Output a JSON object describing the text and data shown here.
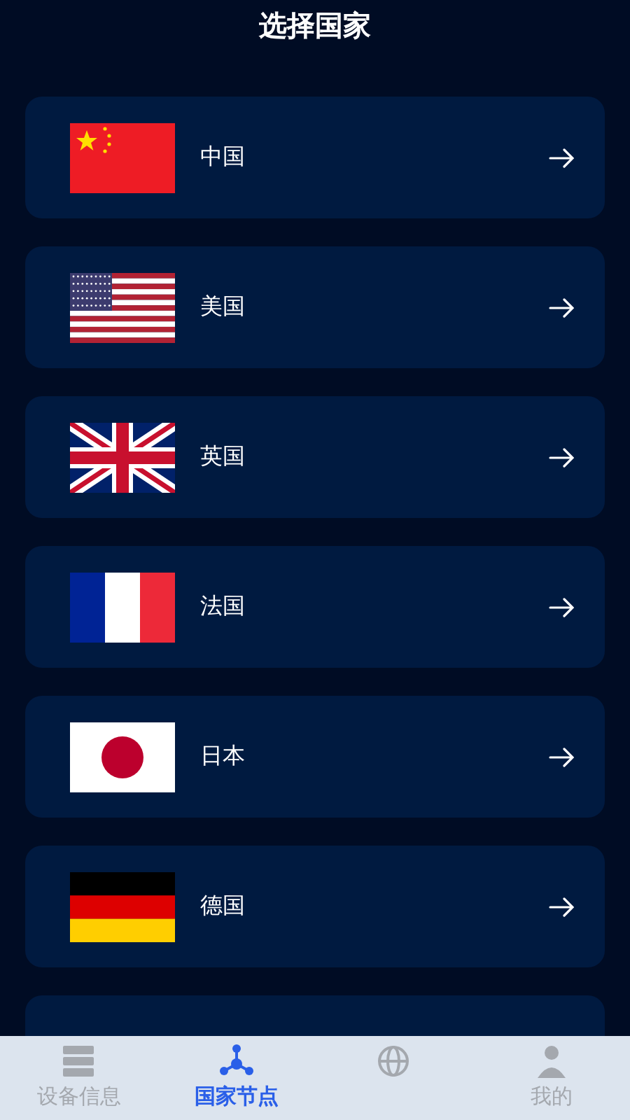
{
  "header": {
    "title": "选择国家"
  },
  "countries": [
    {
      "name": "中国"
    },
    {
      "name": "美国"
    },
    {
      "name": "英国"
    },
    {
      "name": "法国"
    },
    {
      "name": "日本"
    },
    {
      "name": "德国"
    }
  ],
  "tabs": [
    {
      "label": "设备信息",
      "selected": false
    },
    {
      "label": "国家节点",
      "selected": true
    },
    {
      "selected": false
    },
    {
      "label": "我的",
      "selected": false
    }
  ]
}
